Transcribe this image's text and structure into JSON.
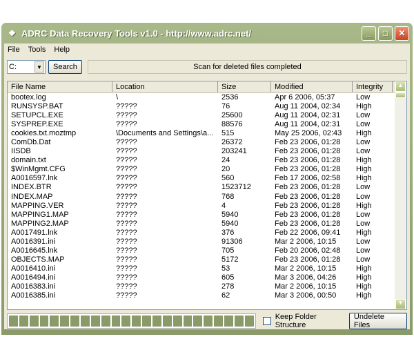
{
  "title": "ADRC Data Recovery Tools v1.0 - http://www.adrc.net/",
  "menu": [
    "File",
    "Tools",
    "Help"
  ],
  "toolbar": {
    "drive": "C:",
    "search": "Search",
    "status": "Scan for deleted files completed"
  },
  "columns": [
    "File Name",
    "Location",
    "Size",
    "Modified",
    "Integrity"
  ],
  "rows": [
    [
      "bootex.log",
      "\\",
      "2536",
      "Apr 6 2006, 05:37",
      "Low"
    ],
    [
      "RUNSYSP.BAT",
      "?????",
      "76",
      "Aug 11 2004, 02:34",
      "High"
    ],
    [
      "SETUPCL.EXE",
      "?????",
      "25600",
      "Aug 11 2004, 02:31",
      "Low"
    ],
    [
      "SYSPREP.EXE",
      "?????",
      "88576",
      "Aug 11 2004, 02:31",
      "Low"
    ],
    [
      "cookies.txt.moztmp",
      "\\Documents and Settings\\a...",
      "515",
      "May 25 2006, 02:43",
      "High"
    ],
    [
      "ComDb.Dat",
      "?????",
      "26372",
      "Feb 23 2006, 01:28",
      "Low"
    ],
    [
      "IISDB",
      "?????",
      "203241",
      "Feb 23 2006, 01:28",
      "Low"
    ],
    [
      "domain.txt",
      "?????",
      "24",
      "Feb 23 2006, 01:28",
      "High"
    ],
    [
      "$WinMgmt.CFG",
      "?????",
      "20",
      "Feb 23 2006, 01:28",
      "High"
    ],
    [
      "A0016597.lnk",
      "?????",
      "560",
      "Feb 17 2006, 02:58",
      "High"
    ],
    [
      "INDEX.BTR",
      "?????",
      "1523712",
      "Feb 23 2006, 01:28",
      "Low"
    ],
    [
      "INDEX.MAP",
      "?????",
      "768",
      "Feb 23 2006, 01:28",
      "Low"
    ],
    [
      "MAPPING.VER",
      "?????",
      "4",
      "Feb 23 2006, 01:28",
      "High"
    ],
    [
      "MAPPING1.MAP",
      "?????",
      "5940",
      "Feb 23 2006, 01:28",
      "Low"
    ],
    [
      "MAPPING2.MAP",
      "?????",
      "5940",
      "Feb 23 2006, 01:28",
      "Low"
    ],
    [
      "A0017491.lnk",
      "?????",
      "376",
      "Feb 22 2006, 09:41",
      "High"
    ],
    [
      "A0016391.ini",
      "?????",
      "91306",
      "Mar 2 2006, 10:15",
      "Low"
    ],
    [
      "A0016645.lnk",
      "?????",
      "705",
      "Feb 20 2006, 02:48",
      "Low"
    ],
    [
      "OBJECTS.MAP",
      "?????",
      "5172",
      "Feb 23 2006, 01:28",
      "Low"
    ],
    [
      "A0016410.ini",
      "?????",
      "53",
      "Mar 2 2006, 10:15",
      "High"
    ],
    [
      "A0016494.ini",
      "?????",
      "605",
      "Mar 3 2006, 04:26",
      "High"
    ],
    [
      "A0016383.ini",
      "?????",
      "278",
      "Mar 2 2006, 10:15",
      "High"
    ],
    [
      "A0016385.ini",
      "?????",
      "62",
      "Mar 3 2006, 00:50",
      "High"
    ]
  ],
  "bottom": {
    "progress_percent": 100,
    "keep_folder": "Keep Folder Structure",
    "keep_folder_checked": false,
    "undelete": "Undelete Files"
  },
  "colors": {
    "theme": "#8a9a68",
    "close": "#d04020"
  }
}
